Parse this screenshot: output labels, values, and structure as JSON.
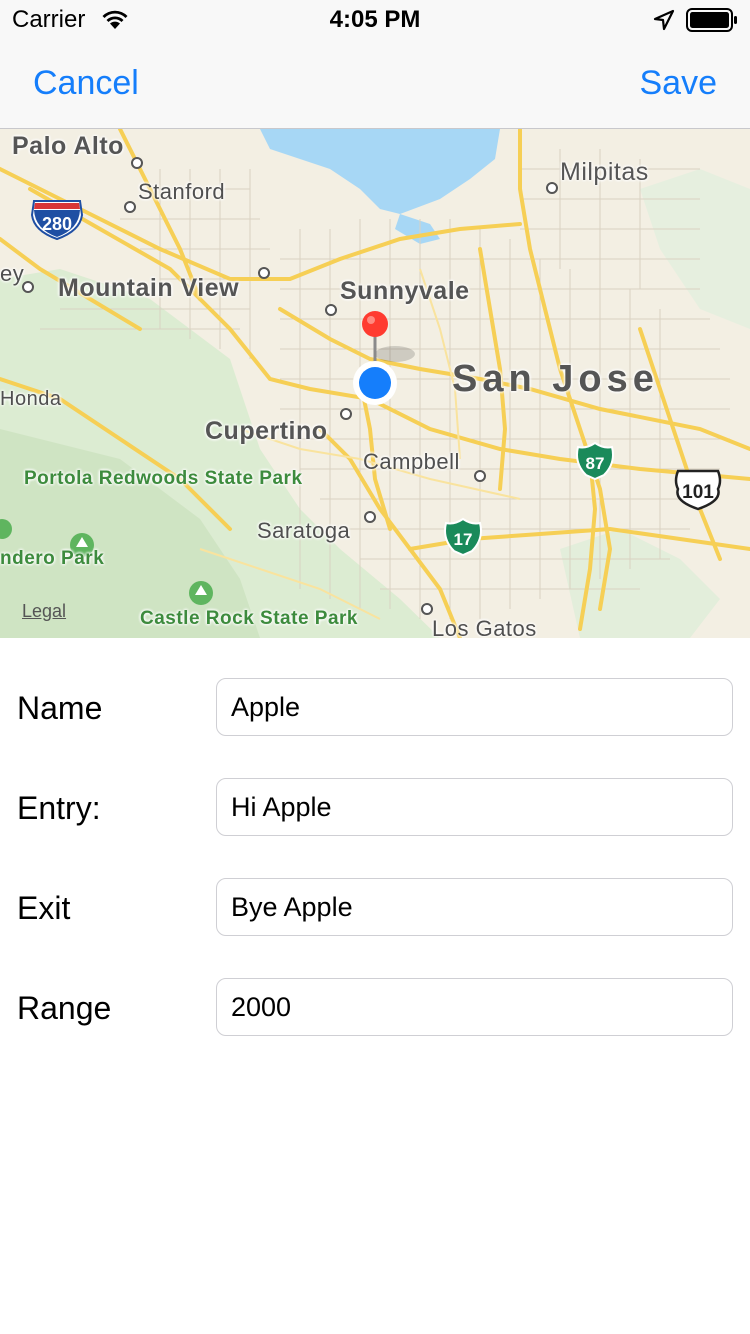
{
  "status_bar": {
    "carrier": "Carrier",
    "time": "4:05 PM",
    "icons": [
      "wifi-icon",
      "location-arrow-icon",
      "battery-icon"
    ]
  },
  "nav": {
    "cancel_label": "Cancel",
    "save_label": "Save",
    "accent_color": "#157EFB"
  },
  "map": {
    "places": {
      "palo_alto": "Palo Alto",
      "stanford": "Stanford",
      "milpitas": "Milpitas",
      "mountain_view": "Mountain View",
      "sunnyvale": "Sunnyvale",
      "san_jose": "San Jose",
      "cupertino": "Cupertino",
      "campbell": "Campbell",
      "saratoga": "Saratoga",
      "los_gatos": "Los Gatos",
      "honda": "Honda",
      "ey": "ey",
      "portola": "Portola Redwoods State Park",
      "castle_rock": "Castle Rock State Park",
      "sandero": "ndero Park"
    },
    "shields": {
      "i280": "280",
      "us101": "101",
      "sr87": "87",
      "sr17": "17"
    },
    "legal_label": "Legal",
    "pin_color": "#FF3B30",
    "user_location_color": "#157EFB"
  },
  "form": {
    "name_label": "Name",
    "name_value": "Apple",
    "entry_label": "Entry:",
    "entry_value": "Hi Apple",
    "exit_label": "Exit",
    "exit_value": "Bye Apple",
    "range_label": "Range",
    "range_value": "2000"
  }
}
